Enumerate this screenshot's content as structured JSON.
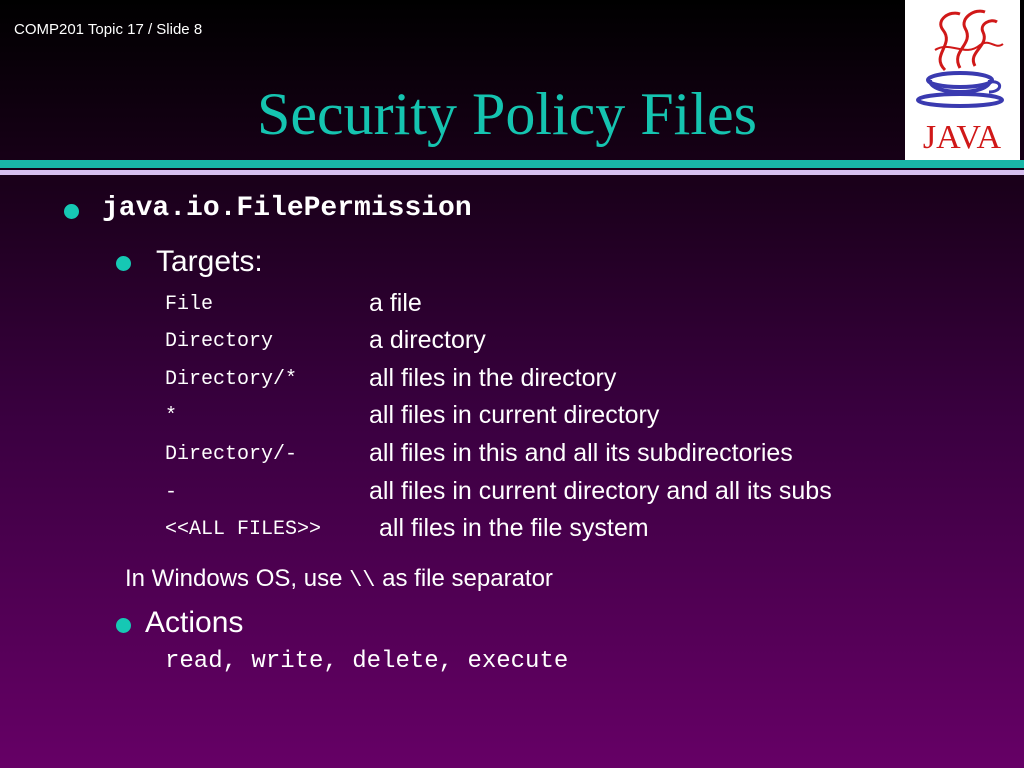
{
  "header": {
    "slide_label": "COMP201 Topic 17 / Slide 8"
  },
  "title": "Security Policy Files",
  "logo": {
    "text": "JAVA",
    "icon": "java-coffee-cup-logo"
  },
  "main_bullet": "java.io.FilePermission",
  "targets": {
    "heading": "Targets:",
    "rows": [
      {
        "code": "File",
        "desc": "a file"
      },
      {
        "code": "Directory",
        "desc": "a directory"
      },
      {
        "code": "Directory/*",
        "desc": "all files in the directory"
      },
      {
        "code": "*",
        "desc": "all files in current directory"
      },
      {
        "code": "Directory/-",
        "desc": "all files in this and all its subdirectories"
      },
      {
        "code": "-",
        "desc": "all files in current directory and all its subs"
      },
      {
        "code": "<<ALL FILES>>",
        "desc": "all files in the file system"
      }
    ]
  },
  "note": {
    "prefix": "In Windows OS, use ",
    "separator": "\\\\",
    "suffix": " as file separator"
  },
  "actions": {
    "heading": "Actions",
    "list": "read, write, delete, execute"
  },
  "colors": {
    "title": "#15c4b0",
    "bullet": "#16c8b4",
    "divider_teal": "#19b7a8",
    "divider_lilac": "#d6c0f0"
  }
}
